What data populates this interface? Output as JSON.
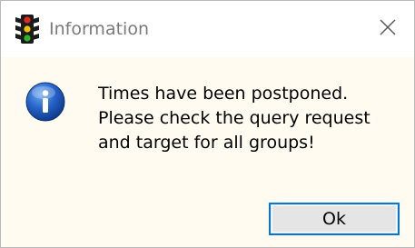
{
  "window": {
    "title": "Information",
    "app_icon": "traffic-light-icon",
    "close_icon": "close-icon"
  },
  "dialog": {
    "icon": "info-icon",
    "message_lines": [
      "Times have been postponed.",
      "Please check the query request",
      "and target for all groups!"
    ],
    "ok_label": "Ok"
  },
  "colors": {
    "title_bg": "#ffffff",
    "content_bg": "#fffbf0",
    "button_border": "#0078d7",
    "button_bg": "#e5e5e5",
    "info_blue": "#1f5fc4"
  }
}
